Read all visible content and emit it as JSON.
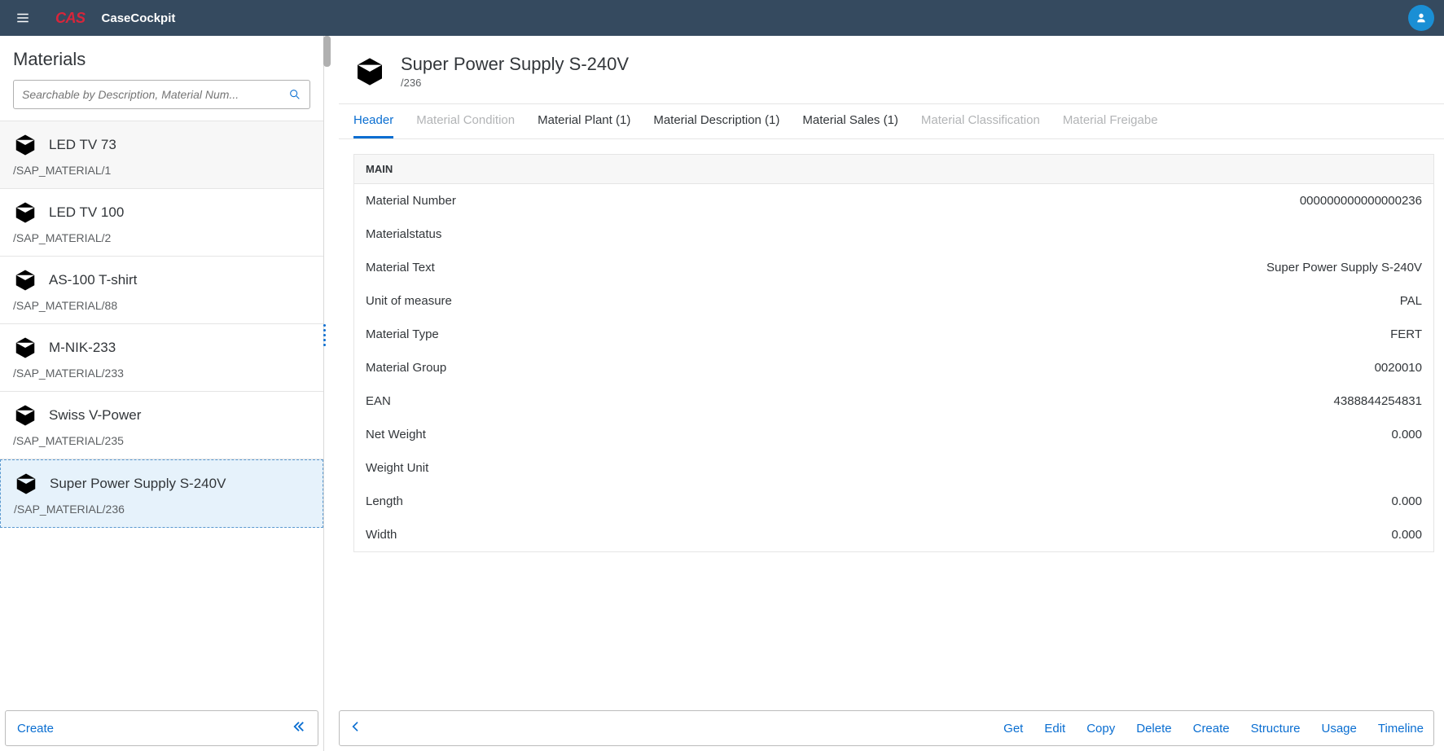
{
  "topbar": {
    "brand": "CAS",
    "app": "CaseCockpit"
  },
  "sidebar": {
    "title": "Materials",
    "search_placeholder": "Searchable by Description, Material Num...",
    "items": [
      {
        "title": "LED TV 73",
        "sub": "/SAP_MATERIAL/1"
      },
      {
        "title": "LED TV 100",
        "sub": "/SAP_MATERIAL/2"
      },
      {
        "title": "AS-100 T-shirt",
        "sub": "/SAP_MATERIAL/88"
      },
      {
        "title": "M-NIK-233",
        "sub": "/SAP_MATERIAL/233"
      },
      {
        "title": "Swiss V-Power",
        "sub": "/SAP_MATERIAL/235"
      },
      {
        "title": "Super Power Supply S-240V",
        "sub": "/SAP_MATERIAL/236"
      }
    ],
    "create_label": "Create"
  },
  "detail": {
    "title": "Super Power Supply S-240V",
    "sub": "/236",
    "tabs": [
      {
        "label": "Header",
        "state": "active"
      },
      {
        "label": "Material Condition",
        "state": "disabled"
      },
      {
        "label": "Material Plant (1)",
        "state": "normal"
      },
      {
        "label": "Material Description (1)",
        "state": "normal"
      },
      {
        "label": "Material Sales (1)",
        "state": "normal"
      },
      {
        "label": "Material Classification",
        "state": "disabled"
      },
      {
        "label": "Material Freigabe",
        "state": "disabled"
      }
    ],
    "section_title": "MAIN",
    "fields": [
      {
        "label": "Material Number",
        "value": "000000000000000236"
      },
      {
        "label": "Materialstatus",
        "value": ""
      },
      {
        "label": "Material Text",
        "value": "Super Power Supply S-240V"
      },
      {
        "label": "Unit of measure",
        "value": "PAL"
      },
      {
        "label": "Material Type",
        "value": "FERT"
      },
      {
        "label": "Material Group",
        "value": "0020010"
      },
      {
        "label": "EAN",
        "value": "4388844254831"
      },
      {
        "label": "Net Weight",
        "value": "0.000"
      },
      {
        "label": "Weight Unit",
        "value": ""
      },
      {
        "label": "Length",
        "value": "0.000"
      },
      {
        "label": "Width",
        "value": "0.000"
      }
    ],
    "actions": [
      "Get",
      "Edit",
      "Copy",
      "Delete",
      "Create",
      "Structure",
      "Usage",
      "Timeline"
    ]
  }
}
